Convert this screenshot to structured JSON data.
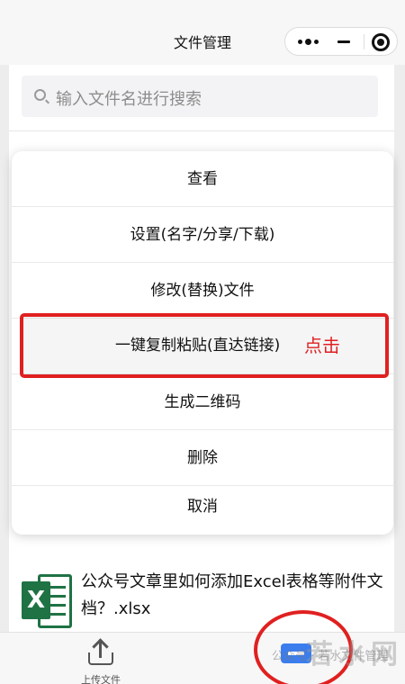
{
  "header": {
    "title": "文件管理"
  },
  "search": {
    "placeholder": "输入文件名进行搜索"
  },
  "action_sheet": {
    "items": [
      {
        "label": "查看"
      },
      {
        "label": "设置(名字/分享/下载)"
      },
      {
        "label": "修改(替换)文件"
      },
      {
        "label": "一键复制粘贴(直达链接)"
      },
      {
        "label": "生成二维码"
      },
      {
        "label": "删除"
      },
      {
        "label": "取消"
      }
    ],
    "highlight_note": "点击"
  },
  "file": {
    "name": "公众号文章里如何添加Excel表格等附件文档？.xlsx",
    "icon_letter": "X"
  },
  "tabbar": {
    "upload_label": "上传文件"
  },
  "watermark": {
    "logo": "若水网",
    "text": "公众号 · 若水文件管理"
  },
  "colors": {
    "accent": "#3b7ded",
    "annotation_red": "#e02020",
    "excel_green": "#1f7244"
  }
}
